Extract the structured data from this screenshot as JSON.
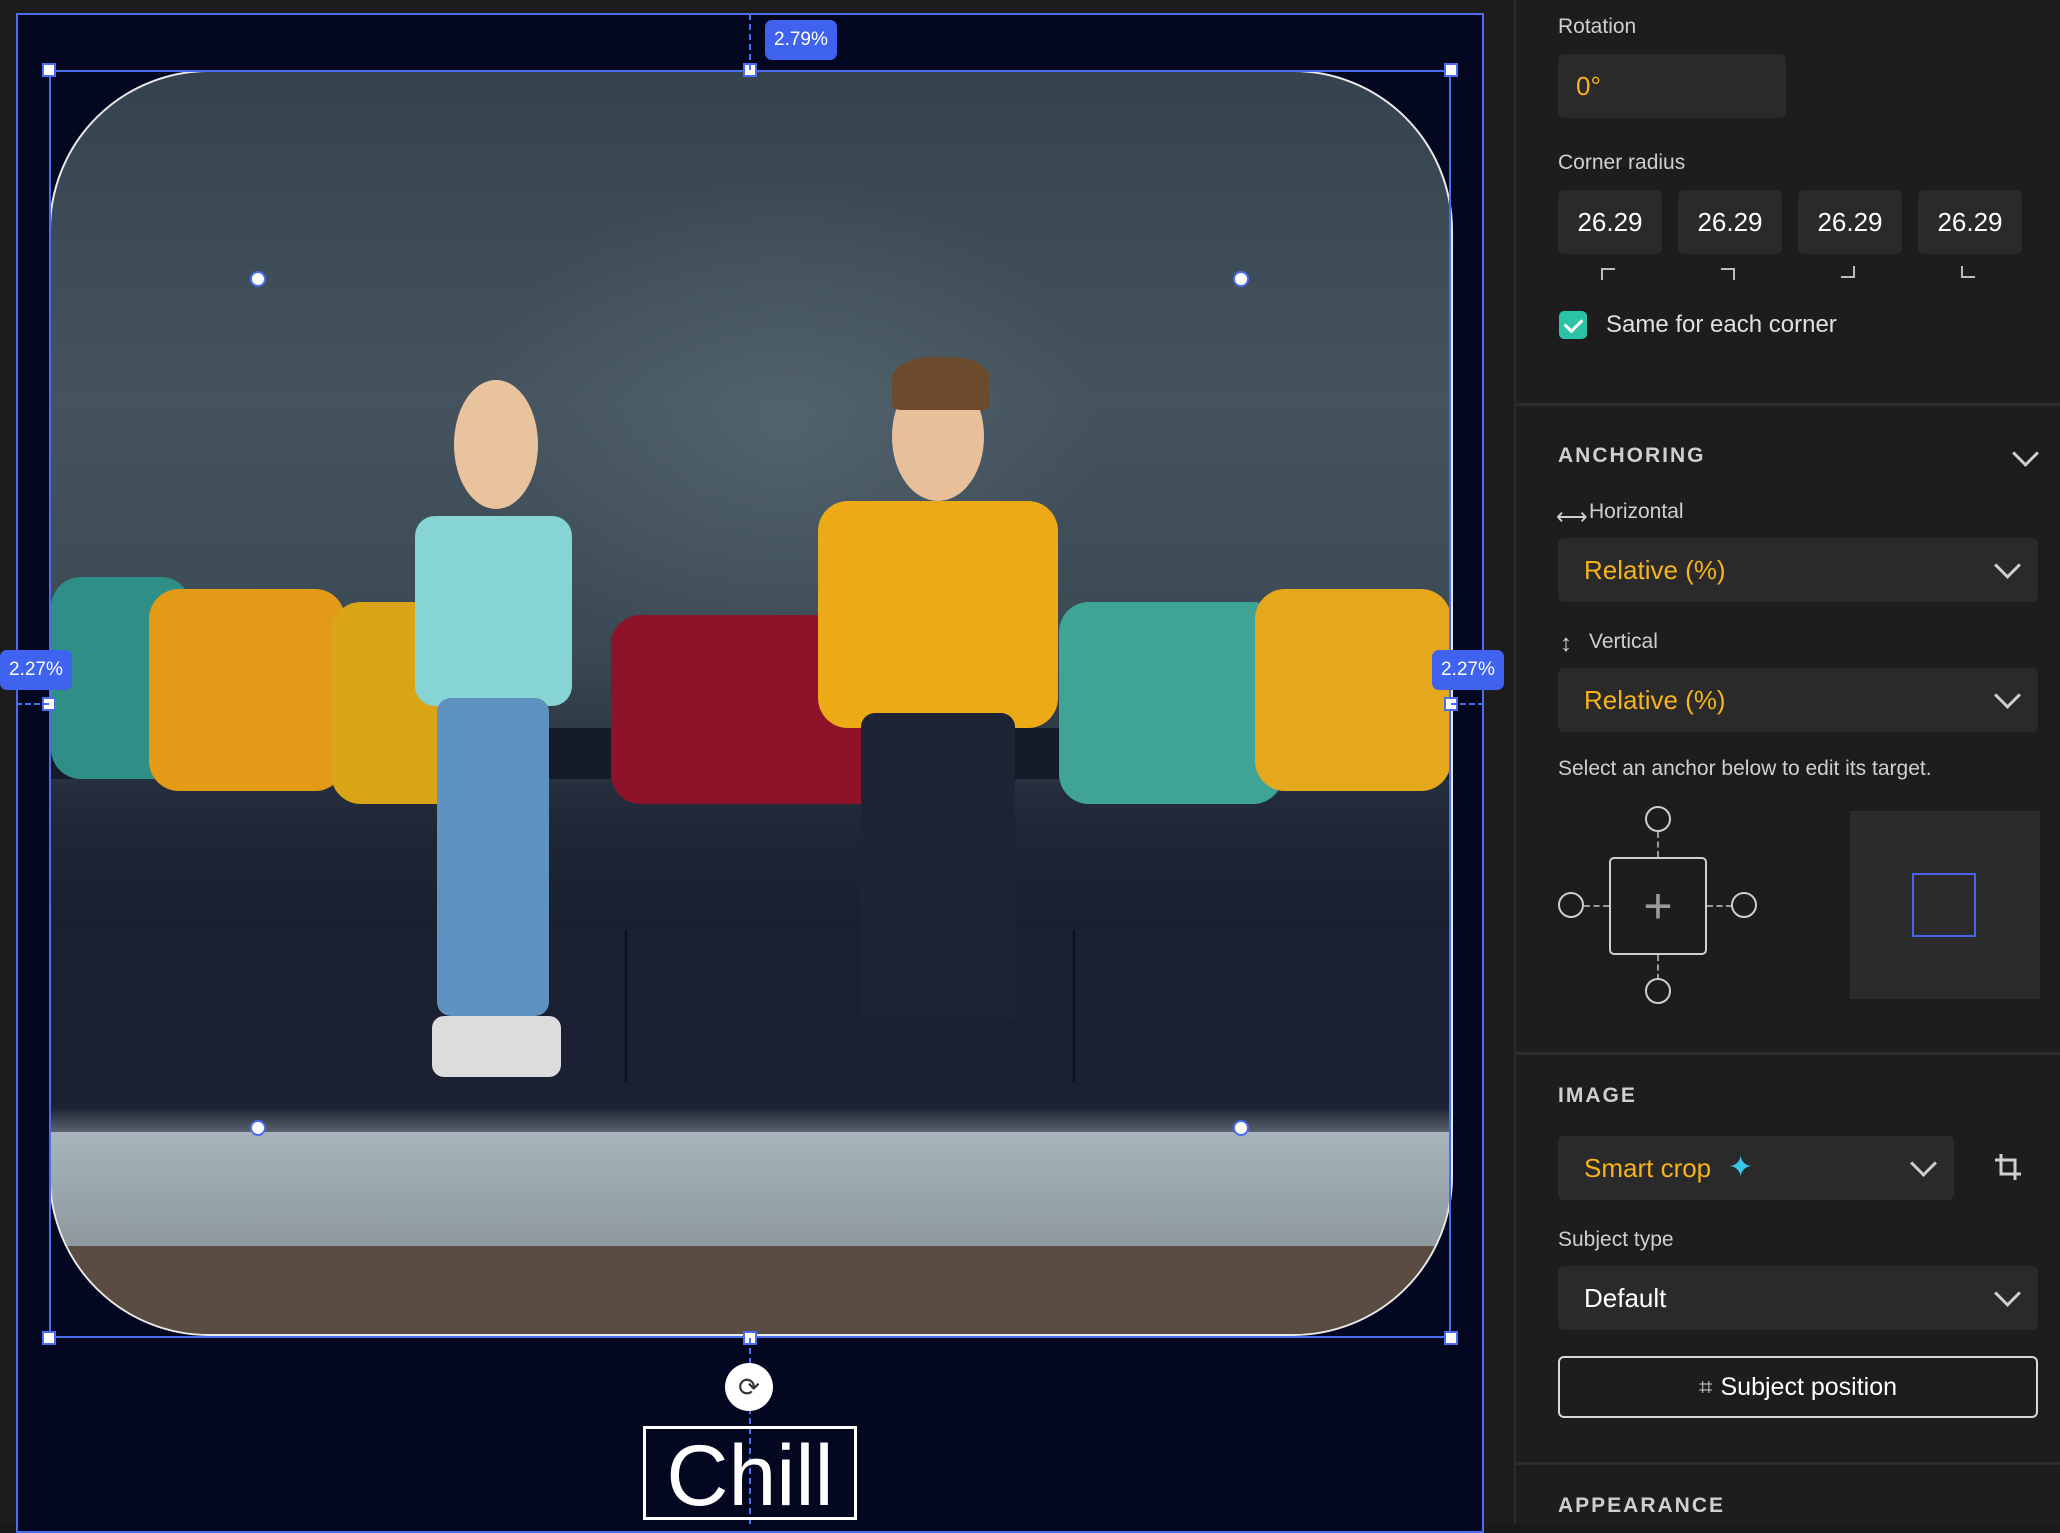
{
  "canvas": {
    "top_margin_badge": "2.79%",
    "left_margin_badge": "2.27%",
    "right_margin_badge": "2.27%",
    "text_layer": "Chill",
    "rotate_icon": "rotate-icon"
  },
  "transform": {
    "rotation_label": "Rotation",
    "rotation_value": "0°",
    "corner_radius_label": "Corner radius",
    "corners": [
      "26.29",
      "26.29",
      "26.29",
      "26.29"
    ],
    "same_corner_label": "Same for each corner",
    "same_corner_checked": true
  },
  "anchoring": {
    "title": "ANCHORING",
    "horizontal_label": "Horizontal",
    "horizontal_value": "Relative (%)",
    "vertical_label": "Vertical",
    "vertical_value": "Relative (%)",
    "hint": "Select an anchor below to edit its target."
  },
  "image": {
    "title": "IMAGE",
    "crop_mode": "Smart crop",
    "subject_type_label": "Subject type",
    "subject_type_value": "Default",
    "subject_position_button": "Subject position"
  },
  "appearance": {
    "title": "APPEARANCE"
  },
  "colors": {
    "accent_blue": "#4a6df0",
    "value_yellow": "#f6b31b",
    "checkbox_teal": "#2bc3a6",
    "artboard_bg": "#030720"
  }
}
